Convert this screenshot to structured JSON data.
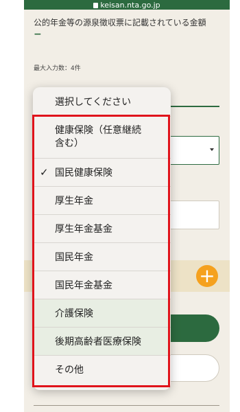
{
  "browser": {
    "url": "keisan.nta.go.jp"
  },
  "form": {
    "amount_label": "公的年金等の源泉徴収票に記載されている金額",
    "amount_value": "−",
    "max_input": "最大入力数：4件",
    "add_icon": "plus-icon"
  },
  "picker": {
    "placeholder": "選択してください",
    "selected_index": 1,
    "items": [
      {
        "label": "健康保険（任意継続\n含む）"
      },
      {
        "label": "国民健康保険",
        "checked": true
      },
      {
        "label": "厚生年金"
      },
      {
        "label": "厚生年金基金"
      },
      {
        "label": "国民年金"
      },
      {
        "label": "国民年金基金"
      },
      {
        "label": "介護保険"
      },
      {
        "label": "後期高齢者医療保険"
      },
      {
        "label": "その他"
      }
    ],
    "highlight_color": "#e0131b"
  }
}
